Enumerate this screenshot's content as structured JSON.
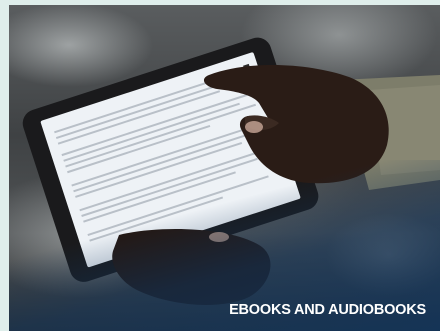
{
  "tile": {
    "caption": "EBOOKS AND AUDIOBOOKS",
    "image_subject": "hands holding a tablet displaying a document",
    "colors": {
      "overlay": "#103c6c",
      "caption": "#ffffff",
      "border": "#dfeeeb"
    }
  }
}
